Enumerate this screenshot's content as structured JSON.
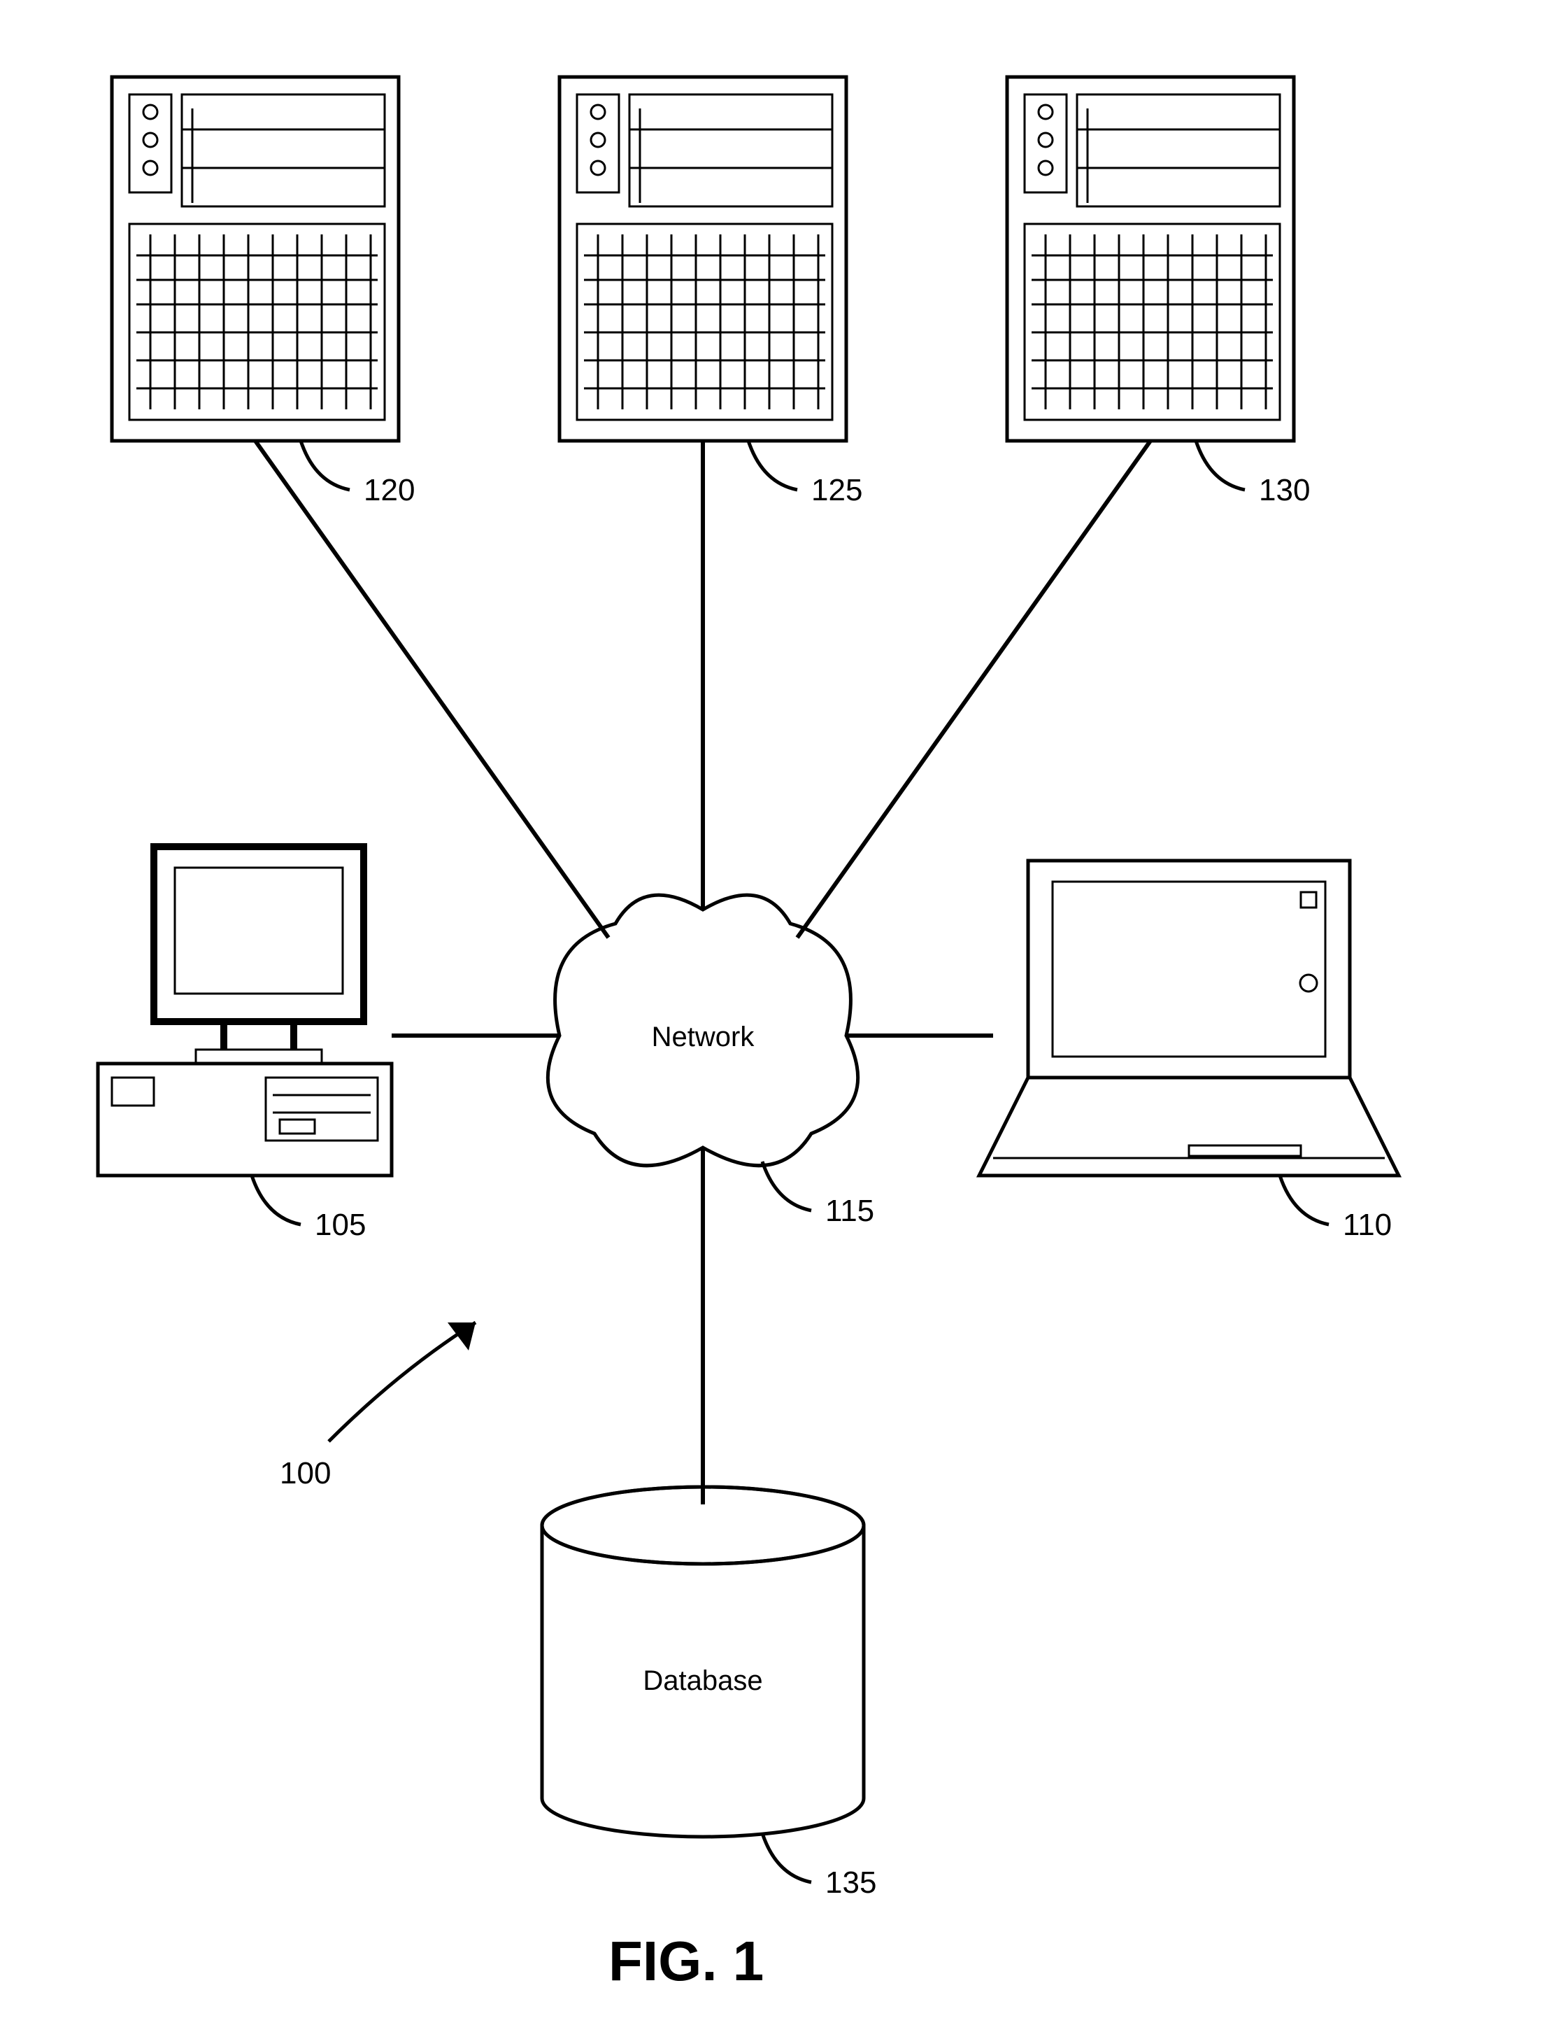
{
  "figure_label": "FIG. 1",
  "refs": {
    "system": "100",
    "desktop": "105",
    "laptop": "110",
    "network": "115",
    "server_left": "120",
    "server_mid": "125",
    "server_right": "130",
    "database": "135"
  },
  "labels": {
    "network": "Network",
    "database": "Database"
  }
}
